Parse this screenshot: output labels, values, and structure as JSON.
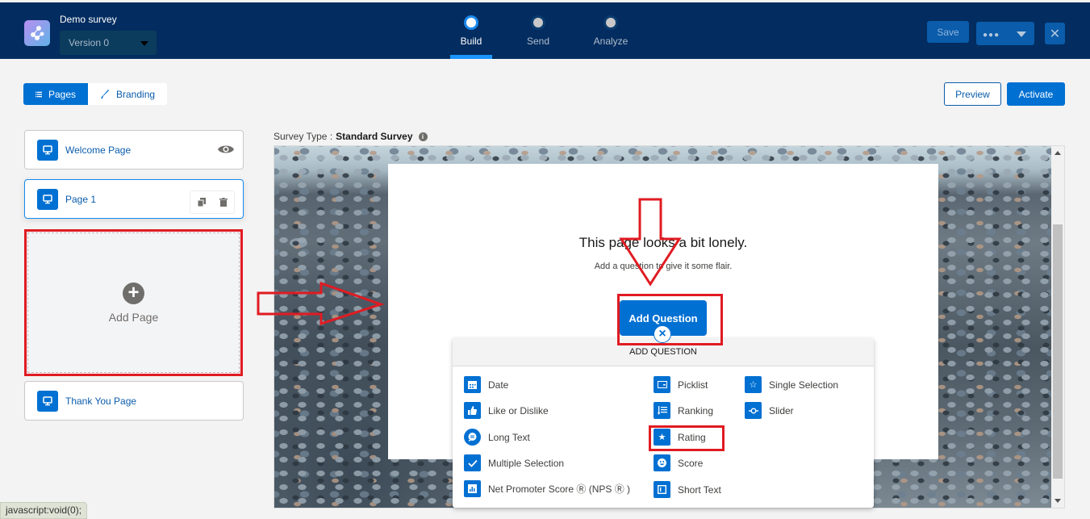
{
  "header": {
    "survey_name": "Demo survey",
    "version": "Version 0",
    "steps": [
      {
        "label": "Build",
        "active": true
      },
      {
        "label": "Send",
        "active": false
      },
      {
        "label": "Analyze",
        "active": false
      }
    ],
    "save_label": "Save",
    "more_label": "●●●",
    "close_label": "✕"
  },
  "toolbar": {
    "tabs": [
      {
        "label": "Pages",
        "active": true
      },
      {
        "label": "Branding",
        "active": false
      }
    ],
    "preview_label": "Preview",
    "activate_label": "Activate"
  },
  "sidebar": {
    "pages": [
      {
        "label": "Welcome Page"
      },
      {
        "label": "Page 1"
      },
      {
        "label": "Thank You Page"
      }
    ],
    "add_page_label": "Add Page"
  },
  "canvas": {
    "survey_type_label": "Survey Type :",
    "survey_type_value": "Standard Survey",
    "empty_title": "This page looks a bit lonely.",
    "empty_subtitle": "Add a question to give it some flair.",
    "add_question_label": "Add Question"
  },
  "question_menu": {
    "title": "ADD QUESTION",
    "items": [
      {
        "label": "Date",
        "icon": "calendar-icon"
      },
      {
        "label": "Like or Dislike",
        "icon": "thumbs-up-icon"
      },
      {
        "label": "Long Text",
        "icon": "chat-icon"
      },
      {
        "label": "Multiple Selection",
        "icon": "check-icon"
      },
      {
        "label": "Net Promoter Score Ⓡ  (NPS Ⓡ )",
        "icon": "bar-chart-icon"
      },
      {
        "label": "Picklist",
        "icon": "picklist-icon"
      },
      {
        "label": "Ranking",
        "icon": "ranking-icon"
      },
      {
        "label": "Rating",
        "icon": "star-icon"
      },
      {
        "label": "Score",
        "icon": "smiley-icon"
      },
      {
        "label": "Short Text",
        "icon": "short-text-icon"
      },
      {
        "label": "Single Selection",
        "icon": "star-outline-icon"
      },
      {
        "label": "Slider",
        "icon": "slider-icon"
      }
    ]
  },
  "status_bar": {
    "text": "javascript:void(0);"
  },
  "colors": {
    "brand_navy": "#032d60",
    "accent_blue": "#0070d2",
    "highlight_red": "#e01b22"
  }
}
